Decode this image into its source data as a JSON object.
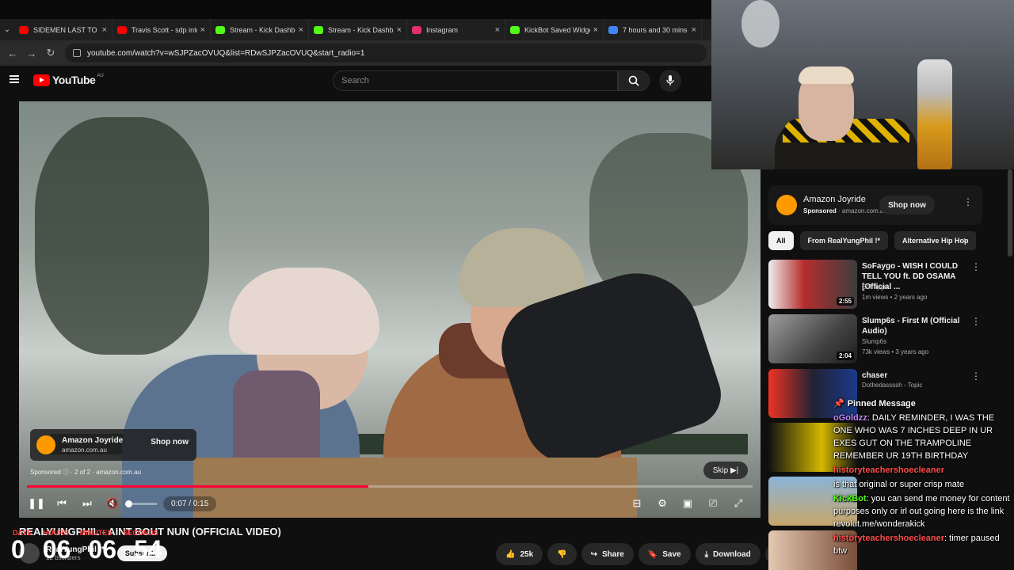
{
  "browser": {
    "tabs": [
      {
        "title": "SIDEMEN LAST TO LE",
        "color": "#ff0000"
      },
      {
        "title": "Travis Scott - sdp inte",
        "color": "#ff0000"
      },
      {
        "title": "Stream - Kick Dashbo",
        "color": "#53fc18"
      },
      {
        "title": "Stream - Kick Dashbo",
        "color": "#53fc18"
      },
      {
        "title": "Instagram",
        "color": "#e1306c"
      },
      {
        "title": "KickBot Saved Widge",
        "color": "#53fc18"
      },
      {
        "title": "7 hours and 30 mins",
        "color": "#4285f4"
      }
    ],
    "url": "youtube.com/watch?v=wSJPZacOVUQ&list=RDwSJPZacOVUQ&start_radio=1"
  },
  "header": {
    "logo_text": "YouTube",
    "country_code": "AU",
    "search_placeholder": "Search"
  },
  "player": {
    "ad": {
      "name": "Amazon Joyride",
      "domain": "amazon.com.au",
      "shop_label": "Shop now",
      "sponsored": "Sponsored",
      "ad_count": "2 of 2",
      "ad_domain": "amazon.com.au"
    },
    "skip_label": "Skip",
    "time": "0:07 / 0:15",
    "progress": 0.47,
    "volume": 0.0
  },
  "video": {
    "title": "REALYUNGPHIL - AINT BOUT NUN (OFFICIAL VIDEO)",
    "channel": "RealYungPhil !*",
    "subscribers": "12",
    "subscribers_suffix": "bscribers",
    "subscribe_label": "Subscribe",
    "likes": "25k",
    "share_label": "Share",
    "save_label": "Save",
    "download_label": "Download"
  },
  "timer": {
    "labels": [
      "DAYS",
      "HOURS",
      "MINUTES",
      "SECONDS"
    ],
    "values": [
      "0",
      "06",
      "06",
      "54"
    ]
  },
  "sidebar": {
    "ad": {
      "name": "Amazon Joyride",
      "sponsored": "Sponsored",
      "domain": "amazon.com.au",
      "shop_label": "Shop now"
    },
    "chips": [
      "All",
      "From RealYungPhil !*",
      "Alternative Hip Hop"
    ],
    "recommendations": [
      {
        "title": "SoFaygo - WISH I COULD TELL YOU ft. DD OSAMA [Official ...",
        "channel": "SoFaygo",
        "meta": "1m views • 2 years ago",
        "duration": "2:55",
        "thumb": "#7b2b2b"
      },
      {
        "title": "Slump6s - First M (Official Audio)",
        "channel": "Slump6s",
        "meta": "73k views • 3 years ago",
        "duration": "2:04",
        "thumb": "#5a5a5a"
      },
      {
        "title": "chaser",
        "channel": "Dothedassssh - Topic",
        "meta": "",
        "duration": "",
        "thumb": "#2e3e7a"
      }
    ]
  },
  "chat": {
    "pinned_label": "Pinned Message",
    "messages": [
      {
        "user": "oGoldzz",
        "color": "#c38bff",
        "text": "DAILY REMINDER, I WAS THE ONE WHO WAS 7 INCHES DEEP IN UR EXES GUT ON THE TRAMPOLINE REMEMBER UR 19TH BIRTHDAY"
      },
      {
        "user": "historyteachershoecleaner",
        "color": "#ff4d4d",
        "text": ""
      },
      {
        "user": "",
        "color": "#ffffff",
        "text": "is that original or super crisp mate"
      },
      {
        "user": "KickBot",
        "color": "#53fc18",
        "text": "you can send me money for content purposes only or irl out going here is the link revolut.me/wonderakick"
      },
      {
        "user": "historyteachershoecleaner",
        "color": "#ff4d4d",
        "text": "timer paused btw"
      }
    ]
  }
}
